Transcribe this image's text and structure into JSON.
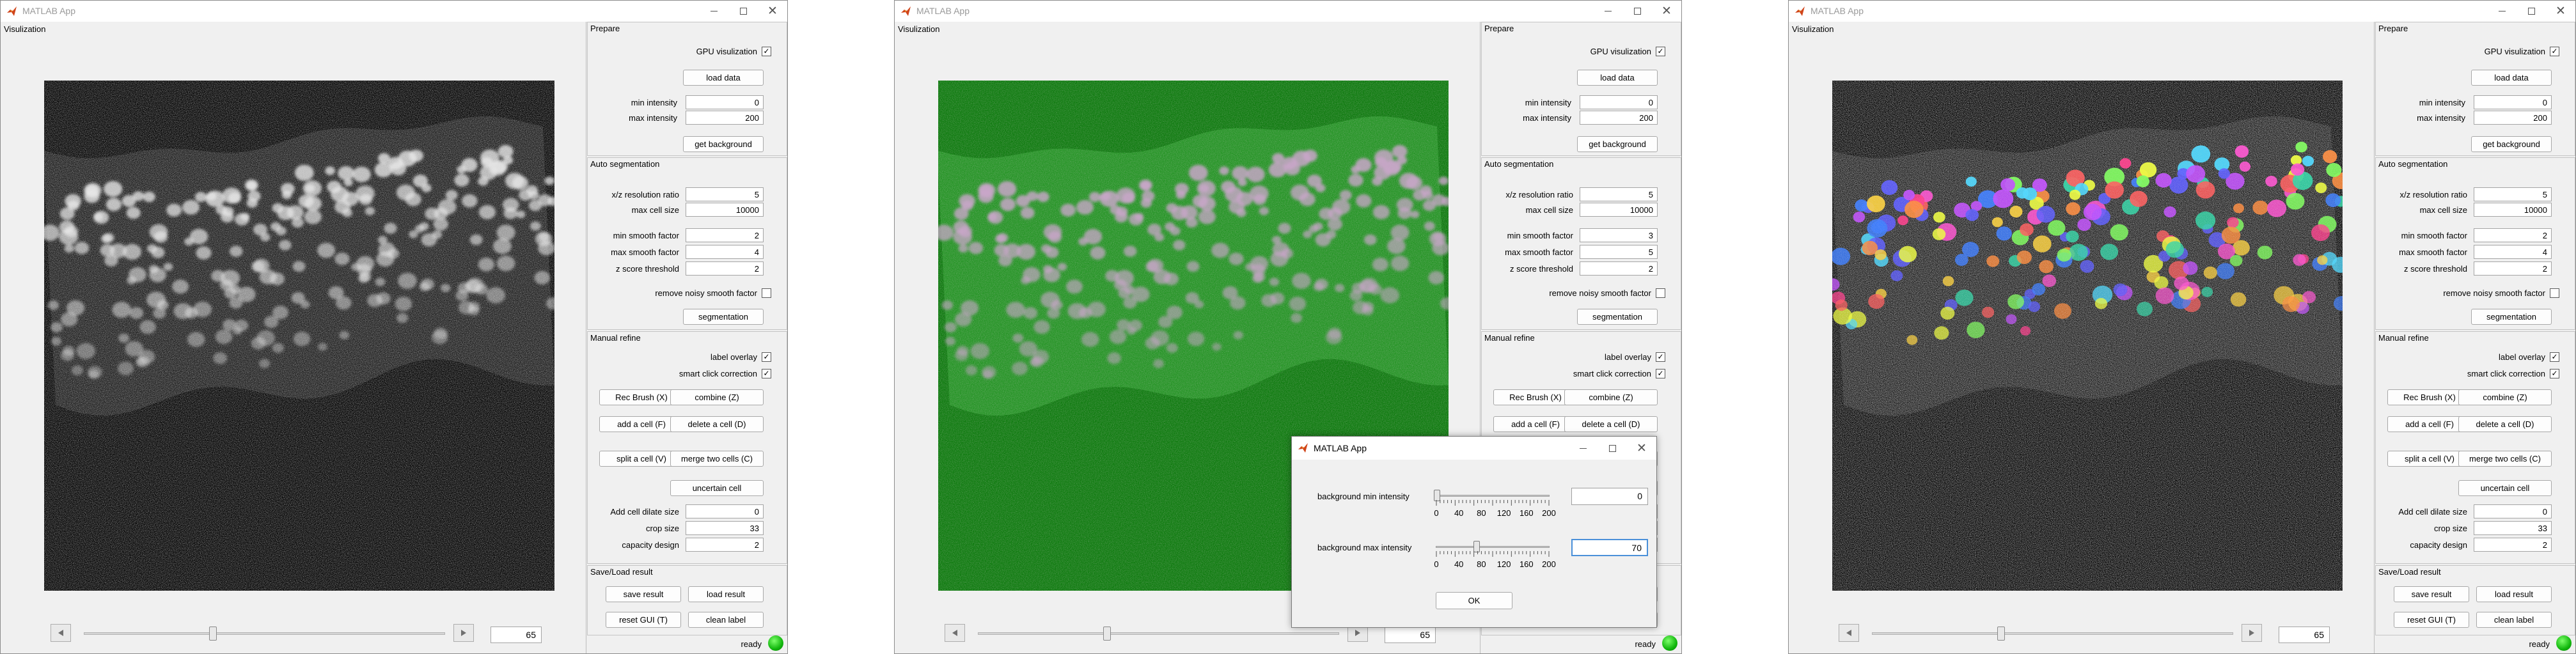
{
  "window_title": "MATLAB App",
  "visualization_title": "Visulization",
  "slice_value": "65",
  "prepare": {
    "title": "Prepare",
    "gpu_label": "GPU visulization",
    "load_data": "load data",
    "min_intensity_label": "min intensity",
    "max_intensity_label": "max intensity",
    "get_background": "get background"
  },
  "auto_seg": {
    "title": "Auto segmentation",
    "xz_label": "x/z resolution ratio",
    "max_cell_label": "max cell size",
    "min_smooth_label": "min smooth factor",
    "max_smooth_label": "max smooth factor",
    "z_score_label": "z score threshold",
    "remove_noisy_label": "remove noisy smooth factor",
    "segmentation": "segmentation"
  },
  "manual": {
    "title": "Manual refine",
    "label_overlay": "label overlay",
    "smart_click": "smart click correction",
    "rec_brush": "Rec Brush (X)",
    "combine": "combine (Z)",
    "add_cell": "add a cell (F)",
    "delete_cell": "delete a cell (D)",
    "split_cell": "split a cell (V)",
    "merge_cells": "merge two cells (C)",
    "uncertain_cell": "uncertain cell",
    "dilate_label": "Add cell dilate size",
    "crop_label": "crop size",
    "capacity_label": "capacity design"
  },
  "saveload": {
    "title": "Save/Load result",
    "save": "save result",
    "load": "load result",
    "reset": "reset GUI (T)",
    "clean": "clean label"
  },
  "status": "ready",
  "windows": [
    {
      "min_intensity": "0",
      "max_intensity": "200",
      "xz_ratio": "5",
      "max_cell_size": "10000",
      "min_smooth": "2",
      "max_smooth": "4",
      "z_score": "2",
      "dilate": "0",
      "crop": "33",
      "capacity": "2"
    },
    {
      "min_intensity": "0",
      "max_intensity": "200",
      "xz_ratio": "5",
      "max_cell_size": "10000",
      "min_smooth": "3",
      "max_smooth": "5",
      "z_score": "2",
      "dilate": "0",
      "crop": "33",
      "capacity": "2"
    },
    {
      "min_intensity": "0",
      "max_intensity": "200",
      "xz_ratio": "5",
      "max_cell_size": "10000",
      "min_smooth": "2",
      "max_smooth": "4",
      "z_score": "2",
      "dilate": "0",
      "crop": "33",
      "capacity": "2"
    }
  ],
  "dialog": {
    "title": "MATLAB App",
    "bg_min_label": "background min intensity",
    "bg_max_label": "background max intensity",
    "bg_min_value": "0",
    "bg_max_value": "70",
    "tick_labels": [
      "0",
      "40",
      "80",
      "120",
      "160",
      "200"
    ],
    "ok": "OK"
  },
  "colors": {
    "status_lamp": "#12b70d",
    "overlay_green": "#1f8f1f"
  }
}
